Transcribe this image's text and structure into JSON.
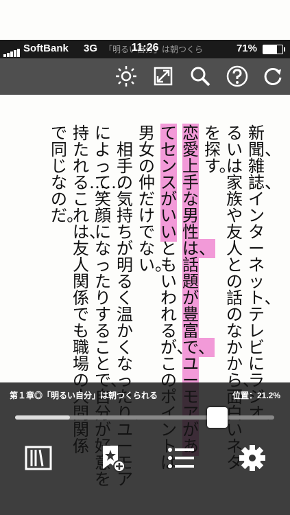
{
  "status": {
    "carrier": "SoftBank",
    "network": "3G",
    "app_title": "「明るい自分」は朝つくら",
    "time": "11:26",
    "battery": "71%",
    "battery_level": 0.71
  },
  "toolbar": {
    "icons": [
      "brightness-icon",
      "fullscreen-icon",
      "search-icon",
      "help-icon",
      "refresh-icon"
    ]
  },
  "text": {
    "columns": [
      {
        "text": "新聞、雑誌、インターネット、テレビにラジオ、"
      },
      {
        "text": "るいは家族や友人との話のなかから、面白いネタ"
      },
      {
        "text": "を探す。"
      },
      {
        "text": "恋愛上手な男性は、話題が豊富で、ユーモアがあ",
        "highlight": true
      },
      {
        "pre": "てセンスがいい",
        "text": "ともいわれるが、このポイントは"
      },
      {
        "text": "男女の仲だけでない。"
      },
      {
        "text": "　相手の気持ちが明るく温かくなったり、ユーモア"
      },
      {
        "text": "によって笑顔になったりすることで、自分が好意を"
      },
      {
        "text": "持たれる……これは、友人関係でも職場の人間関係"
      },
      {
        "text": "で同じなのだ。"
      }
    ]
  },
  "bottom": {
    "chapter": "第１章◎「明るい自分」は朝つくられる",
    "position": "位置：21.2%",
    "progress": 0.212,
    "icons": [
      "bookshelf-icon",
      "add-bookmark-icon",
      "list-icon",
      "settings-icon"
    ]
  }
}
